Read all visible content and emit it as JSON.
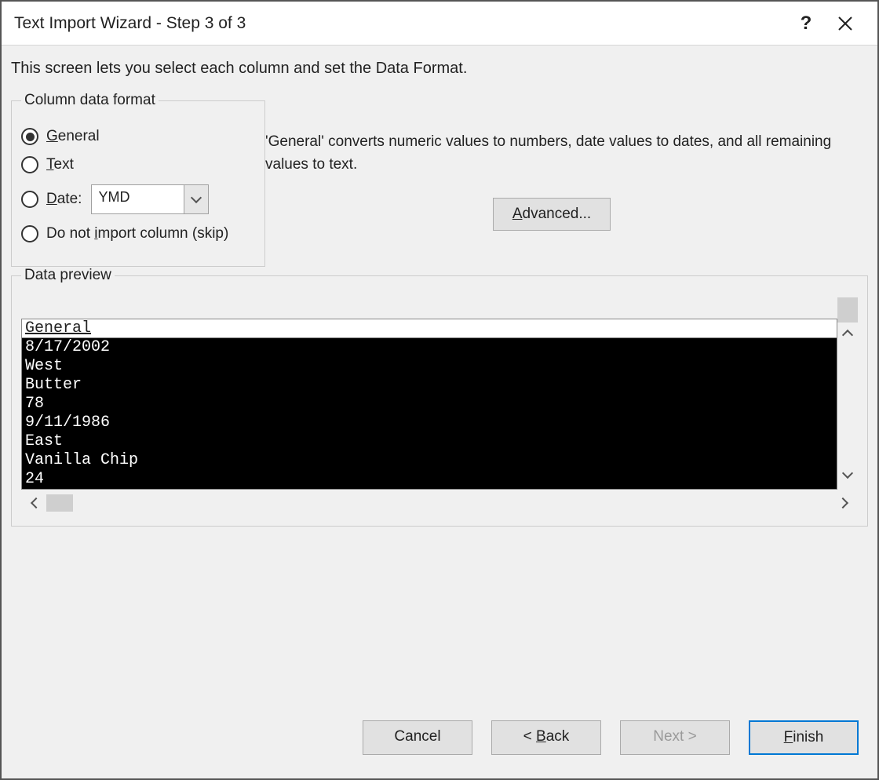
{
  "title": "Text Import Wizard - Step 3 of 3",
  "instruction": "This screen lets you select each column and set the Data Format.",
  "format_group": {
    "legend": "Column data format",
    "options": {
      "general": "General",
      "text": "Text",
      "date": "Date:",
      "skip": "Do not import column (skip)"
    },
    "date_value": "YMD"
  },
  "description": "'General' converts numeric values to numbers, date values to dates, and all remaining values to text.",
  "advanced_label": "Advanced...",
  "preview": {
    "legend": "Data preview",
    "column_header": "General",
    "rows": [
      "8/17/2002",
      "West",
      "Butter",
      "78",
      "9/11/1986",
      "East",
      "Vanilla Chip",
      "24"
    ]
  },
  "buttons": {
    "cancel": "Cancel",
    "back": "< Back",
    "next": "Next >",
    "finish": "Finish"
  }
}
